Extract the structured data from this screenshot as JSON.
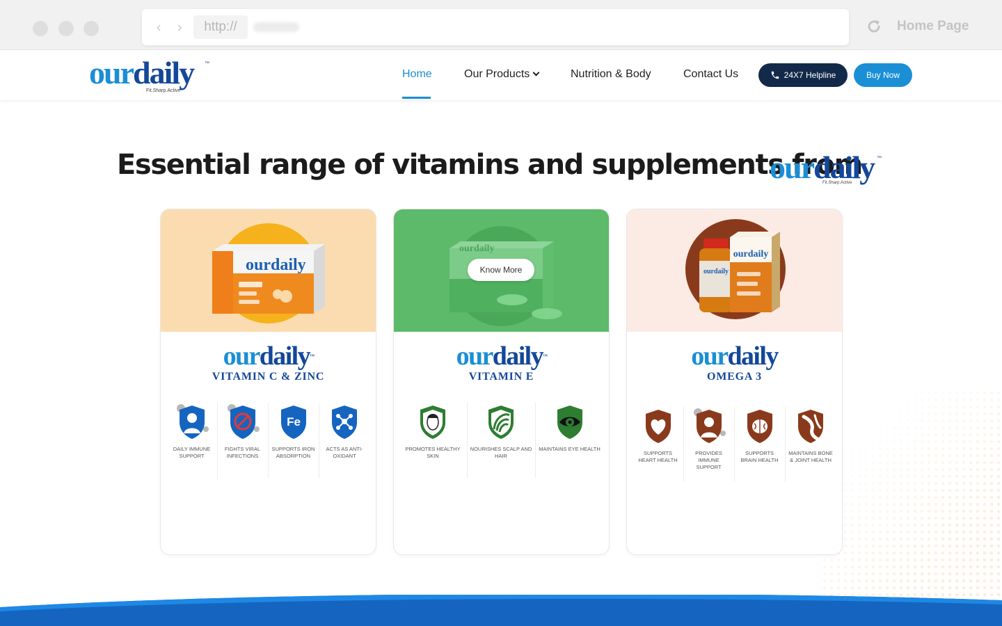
{
  "browser": {
    "protocol": "http://",
    "tab_title": "Home Page"
  },
  "brand": {
    "name_part1": "our",
    "name_part2": "daily",
    "tagline": "Fit.Sharp.Active",
    "trademark": "™",
    "colors": {
      "light_blue": "#1b8ed6",
      "dark_blue": "#13479a",
      "navy": "#12294a"
    }
  },
  "nav": {
    "items": [
      {
        "label": "Home",
        "active": true
      },
      {
        "label": "Our Products",
        "has_dropdown": true
      },
      {
        "label": "Nutrition & Body"
      },
      {
        "label": "Contact Us"
      }
    ],
    "helpline_label": "24X7 Helpline",
    "buy_label": "Buy Now"
  },
  "hero": {
    "title": "Essential range of vitamins and supplements from"
  },
  "products": [
    {
      "variant": "VITAMIN C & ZINC",
      "bg_color": "#fbdcb0",
      "benefits": [
        {
          "icon": "person-shield-icon",
          "label": "DAILY IMMUNE SUPPORT"
        },
        {
          "icon": "virus-shield-icon",
          "label": "FIGHTS VIRAL INFECTIONS"
        },
        {
          "icon": "fe-shield-icon",
          "label": "SUPPORTS IRON ABSORPTION"
        },
        {
          "icon": "molecule-shield-icon",
          "label": "ACTS AS ANTI-OXIDANT"
        }
      ]
    },
    {
      "variant": "VITAMIN E",
      "bg_color": "#5cba6a",
      "hover_button": "Know More",
      "benefits": [
        {
          "icon": "face-shield-icon",
          "label": "PROMOTES HEALTHY SKIN"
        },
        {
          "icon": "hair-shield-icon",
          "label": "NOURISHES SCALP AND HAIR"
        },
        {
          "icon": "eye-shield-icon",
          "label": "MAINTAINS EYE HEALTH"
        }
      ]
    },
    {
      "variant": "OMEGA 3",
      "bg_color": "#fcebe4",
      "benefits": [
        {
          "icon": "heart-shield-icon",
          "label": "SUPPORTS HEART HEALTH"
        },
        {
          "icon": "immune-shield-icon",
          "label": "PROVIDES IMMUNE SUPPORT"
        },
        {
          "icon": "brain-shield-icon",
          "label": "SUPPORTS BRAIN HEALTH"
        },
        {
          "icon": "joint-shield-icon",
          "label": "MAINTAINS BONE & JOINT HEALTH"
        }
      ]
    }
  ]
}
